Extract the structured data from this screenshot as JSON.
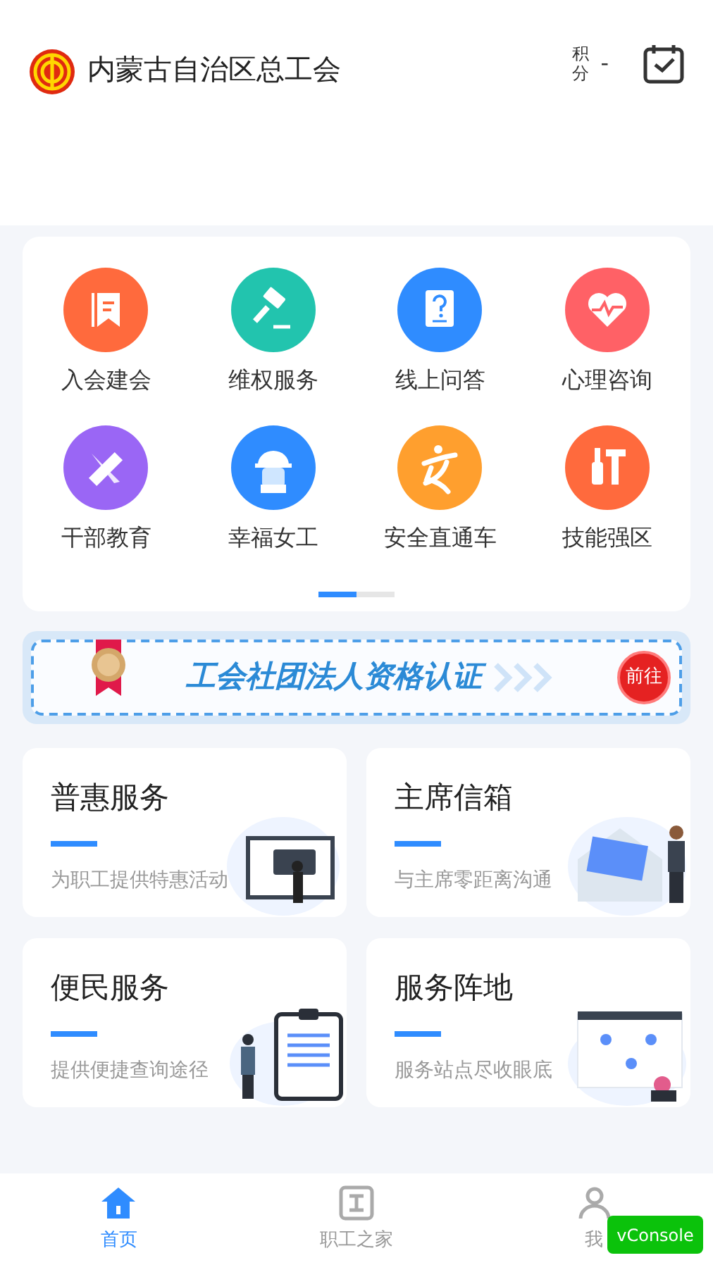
{
  "header": {
    "title": "内蒙古自治区总工会",
    "points_label": "积分",
    "points_value": "-"
  },
  "shortcuts": [
    {
      "label": "入会建会",
      "color": "#ff6a3d",
      "kind": "bookmark"
    },
    {
      "label": "维权服务",
      "color": "#22c4ae",
      "kind": "gavel"
    },
    {
      "label": "线上问答",
      "color": "#2f8cff",
      "kind": "question"
    },
    {
      "label": "心理咨询",
      "color": "#ff6166",
      "kind": "heart"
    },
    {
      "label": "干部教育",
      "color": "#9a66f5",
      "kind": "ruler"
    },
    {
      "label": "幸福女工",
      "color": "#2f8cff",
      "kind": "worker"
    },
    {
      "label": "安全直通车",
      "color": "#ff9f2e",
      "kind": "runner"
    },
    {
      "label": "技能强区",
      "color": "#ff6a3d",
      "kind": "tools"
    }
  ],
  "pager": [
    {
      "selected": true
    },
    {
      "selected": false
    }
  ],
  "banner": {
    "title": "工会社团法人资格认证",
    "button": "前往"
  },
  "service_cards": [
    {
      "title": "普惠服务",
      "subtitle": "为职工提供特惠活动",
      "kind": "monitor"
    },
    {
      "title": "主席信箱",
      "subtitle": "与主席零距离沟通",
      "kind": "envelope"
    },
    {
      "title": "便民服务",
      "subtitle": "提供便捷查询途径",
      "kind": "clipboard"
    },
    {
      "title": "服务阵地",
      "subtitle": "服务站点尽收眼底",
      "kind": "map"
    }
  ],
  "tab_bar": [
    {
      "label": "首页",
      "selected": true,
      "kind": "home"
    },
    {
      "label": "职工之家",
      "selected": false,
      "kind": "work"
    },
    {
      "label": "我",
      "selected": false,
      "kind": "user"
    }
  ],
  "debug_button": "vConsole"
}
